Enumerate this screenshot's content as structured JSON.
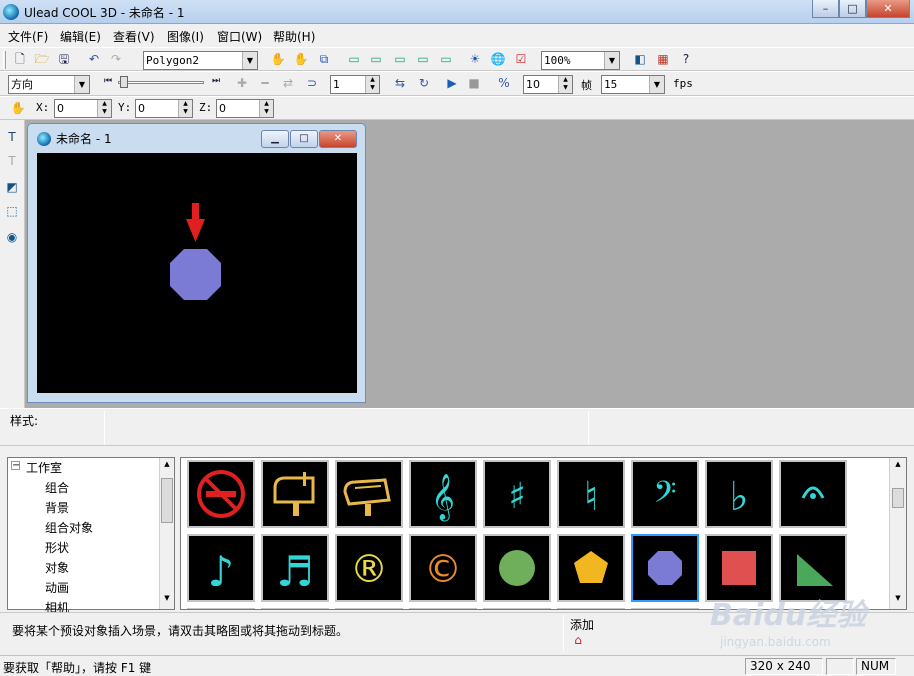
{
  "window": {
    "title": "Ulead COOL 3D - 未命名 - 1",
    "min": "–",
    "max": "□",
    "close": "✕"
  },
  "menu": [
    "文件(F)",
    "编辑(E)",
    "查看(V)",
    "图像(I)",
    "窗口(W)",
    "帮助(H)"
  ],
  "toolbar1": {
    "object_combo": "Polygon2",
    "zoom_combo": "100%"
  },
  "toolbar2": {
    "attribute_combo": "方向",
    "frame_spin": "1",
    "frame_count_spin": "10",
    "frames_label": "帧",
    "fps_combo": "15",
    "fps_label": "fps"
  },
  "toolbar3": {
    "x_label": "X:",
    "x_value": "0",
    "y_label": "Y:",
    "y_value": "0",
    "z_label": "Z:",
    "z_value": "0"
  },
  "document": {
    "title": "未命名 - 1"
  },
  "style_panel": {
    "label": "样式:"
  },
  "tree": {
    "root": "工作室",
    "items": [
      "组合",
      "背景",
      "组合对象",
      "形状",
      "对象",
      "动画",
      "相机"
    ]
  },
  "gallery": {
    "row1": [
      "no-smoking",
      "mailbox",
      "mailbox-open",
      "treble-clef",
      "sharp",
      "natural",
      "bass-clef",
      "flat",
      "fermata"
    ],
    "row2": [
      "eighth-note",
      "sixteenth-note",
      "registered",
      "copyright",
      "circle",
      "pentagon",
      "octagon",
      "square",
      "triangle"
    ],
    "selected": "octagon",
    "symbols": {
      "registered": "®",
      "copyright": "©",
      "treble": "𝄞",
      "sharp": "♯",
      "natural": "♮",
      "bass": "𝄢",
      "flat": "♭",
      "fermata": "𝄐",
      "eighth": "♪",
      "sixteenth": "♬"
    }
  },
  "hint": {
    "text": "要将某个预设对象插入场景，请双击其略图或将其拖动到标题。",
    "add_label": "添加"
  },
  "status": {
    "help": "要获取「帮助」，请按 F1 键",
    "size": "320 x 240",
    "num": "NUM"
  },
  "watermark": {
    "logo": "Baidu经验",
    "url": "jingyan.baidu.com"
  },
  "colors": {
    "octagon": "#7b7bd6",
    "arrow": "#e02020",
    "teal": "#33d6d6",
    "gold": "#e8b84a"
  }
}
